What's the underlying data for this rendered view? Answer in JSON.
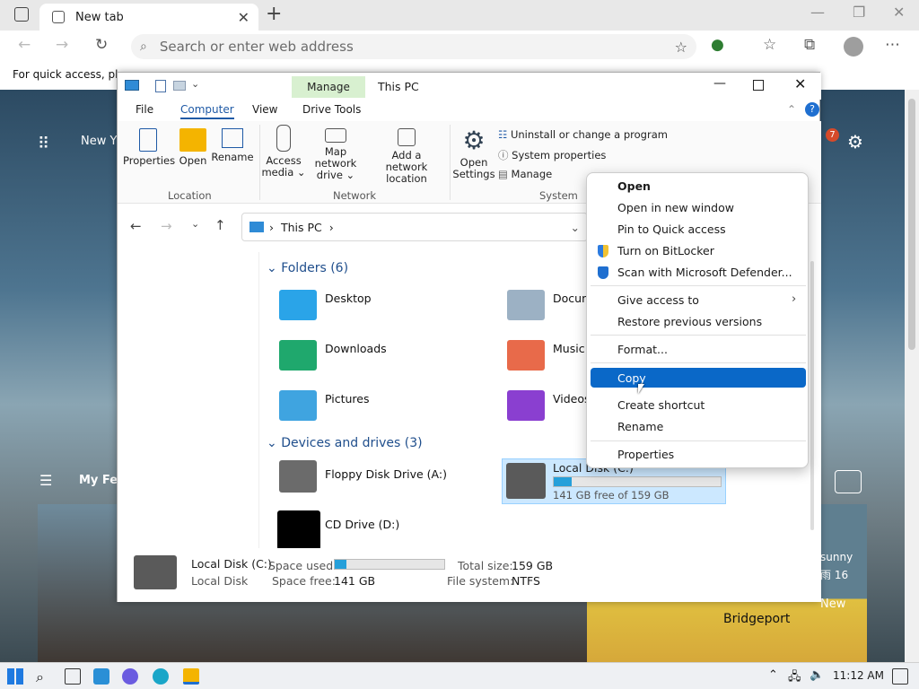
{
  "browser": {
    "tab_title": "New tab",
    "address_placeholder": "Search or enter web address",
    "favorites_hint": "For quick access, plac"
  },
  "page": {
    "new_label": "New Y",
    "myfeed_label": "My Fe",
    "notif_count": "7",
    "weather_text": "sunny",
    "weather_temp": "雨 16",
    "weather_city": "Bridgeport",
    "weather_new": "New"
  },
  "explorer": {
    "title": "This PC",
    "manage_tab": "Manage",
    "tabs": [
      "File",
      "Computer",
      "View",
      "Drive Tools"
    ],
    "ribbon": {
      "properties": "Properties",
      "open": "Open",
      "rename": "Rename",
      "access_media": "Access media ⌄",
      "map_drive_1": "Map network",
      "map_drive_2": "drive ⌄",
      "add_location_1": "Add a network",
      "add_location_2": "location",
      "open_settings_1": "Open",
      "open_settings_2": "Settings",
      "uninstall": "Uninstall or change a program",
      "system_properties": "System properties",
      "manage": "Manage",
      "group_location": "Location",
      "group_network": "Network",
      "group_system": "System"
    },
    "path": "This PC",
    "folders_header": "Folders (6)",
    "folders": [
      "Desktop",
      "Docum",
      "Downloads",
      "Music",
      "Pictures",
      "Videos"
    ],
    "devices_header": "Devices and drives (3)",
    "devices": {
      "floppy": "Floppy Disk Drive (A:)",
      "local_disk": "Local Disk (C:)",
      "local_free": "141 GB free of 159 GB",
      "local_used_fraction": 0.11,
      "cd": "CD Drive (D:)"
    },
    "details": {
      "name": "Local Disk (C:)",
      "type": "Local Disk",
      "space_used_label": "Space used:",
      "space_free_label": "Space free:",
      "space_free": "141 GB",
      "total_size_label": "Total size:",
      "total_size": "159 GB",
      "filesystem_label": "File system:",
      "filesystem": "NTFS"
    }
  },
  "context_menu": {
    "items": [
      "Open",
      "Open in new window",
      "Pin to Quick access",
      "Turn on BitLocker",
      "Scan with Microsoft Defender...",
      "Give access to",
      "Restore previous versions",
      "Format...",
      "Copy",
      "Create shortcut",
      "Rename",
      "Properties"
    ],
    "selected": "Copy"
  },
  "taskbar": {
    "time": "11:12 AM"
  },
  "colors": {
    "accent": "#0a68c8",
    "manage_tab": "#d8f0d0",
    "selection": "#cce8ff"
  }
}
